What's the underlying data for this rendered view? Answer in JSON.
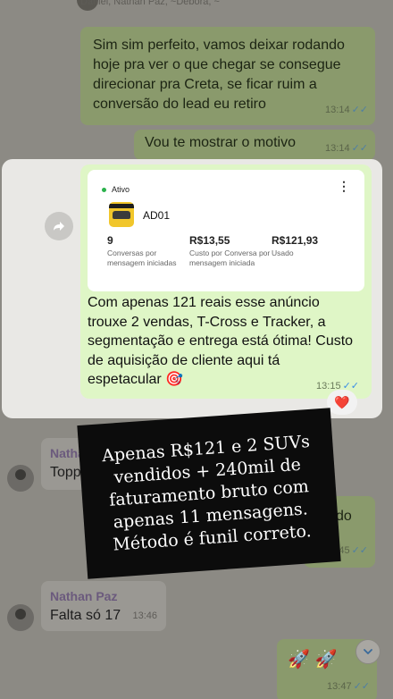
{
  "header": {
    "participants": "Daniel, Nathan Paz, ~Débora, ~"
  },
  "messages": [
    {
      "id": "m1",
      "text": "Sim sim perfeito, vamos deixar rodando hoje pra ver o que chegar se consegue direcionar pra Creta, se ficar ruim a conversão do lead eu retiro",
      "time": "13:14"
    },
    {
      "id": "m2",
      "text": "Vou te mostrar o motivo",
      "time": "13:14"
    },
    {
      "id": "m5",
      "text": "Topp"
    },
    {
      "id": "m6",
      "fragment_top": "do",
      "time": "13:45"
    },
    {
      "id": "m7",
      "sender": "Nathan Paz",
      "text": "Falta só 17",
      "time": "13:46"
    },
    {
      "id": "m8",
      "text": "🚀 🚀",
      "time": "13:47"
    }
  ],
  "highlight": {
    "ad_card": {
      "status": "Ativo",
      "ad_name": "AD01",
      "stats": [
        {
          "value": "9",
          "label": "Conversas por mensagem iniciadas"
        },
        {
          "value": "R$13,55",
          "label": "Custo por Conversa por mensagem iniciada"
        },
        {
          "value": "R$121,93",
          "label": "Usado"
        }
      ]
    },
    "text": "Com apenas 121 reais esse anúncio trouxe 2 vendas, T-Cross e Tracker, a segmentação e entrega está ótima! Custo de aquisição de cliente aqui tá espetacular 🎯",
    "time": "13:15",
    "reaction": "❤️"
  },
  "lower": {
    "sender_partial": "Natha"
  },
  "overlay": {
    "text": "Apenas R$121 e 2 SUVs vendidos + 240mil de faturamento bruto com apenas 11 mensagens. Método é funil correto."
  },
  "colors": {
    "outgoing_bubble": "#dff6c6",
    "dimmed_bg": "#8c8a84",
    "read_ticks": "#3a8ee6",
    "active_dot": "#2bb14c"
  },
  "icons": {
    "share": "share-forward-icon",
    "kebab": "more-options-icon",
    "scroll": "chevron-down-icon"
  }
}
